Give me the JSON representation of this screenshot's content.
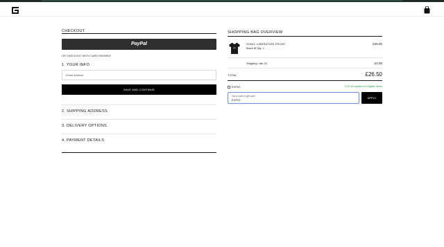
{
  "colors": {
    "accent": "#2e9e3e",
    "button": "#000000",
    "paypal": "#2f2f2f",
    "focus": "#6b8fd6"
  },
  "header": {
    "logo_icon": "brand-logo-icon",
    "bag_icon": "shopping-bag-icon"
  },
  "checkout": {
    "title": "Checkout",
    "paypal_label": "PayPal",
    "or_text": "OR CHECKOUT WITH CARD PAYMENT",
    "step1": "1. YOUR INFO",
    "email_placeholder": "Email address",
    "save_label": "SAVE AND CONTINUE",
    "step2": "2. SHIPPING ADDRESS",
    "step3": "3. DELIVERY OPTIONS",
    "step4": "4. PAYMENT DETAILS"
  },
  "bag": {
    "title": "Shopping Bag Overview",
    "product_name": "SONIC LIBERATION FRONT",
    "product_meta": "Black  M  Qty: 1",
    "product_price": "£25.00",
    "shipping_label": "Shipping: Jan 20",
    "shipping_price": "£4.00",
    "total_label": "TOTAL",
    "total_price": "£26.50",
    "promo_code": "EVPIO",
    "promo_note": "10% off applied on eligible items",
    "code_label": "Got a code or gift card?",
    "code_value": "EVPIO",
    "apply_label": "APPLY"
  }
}
